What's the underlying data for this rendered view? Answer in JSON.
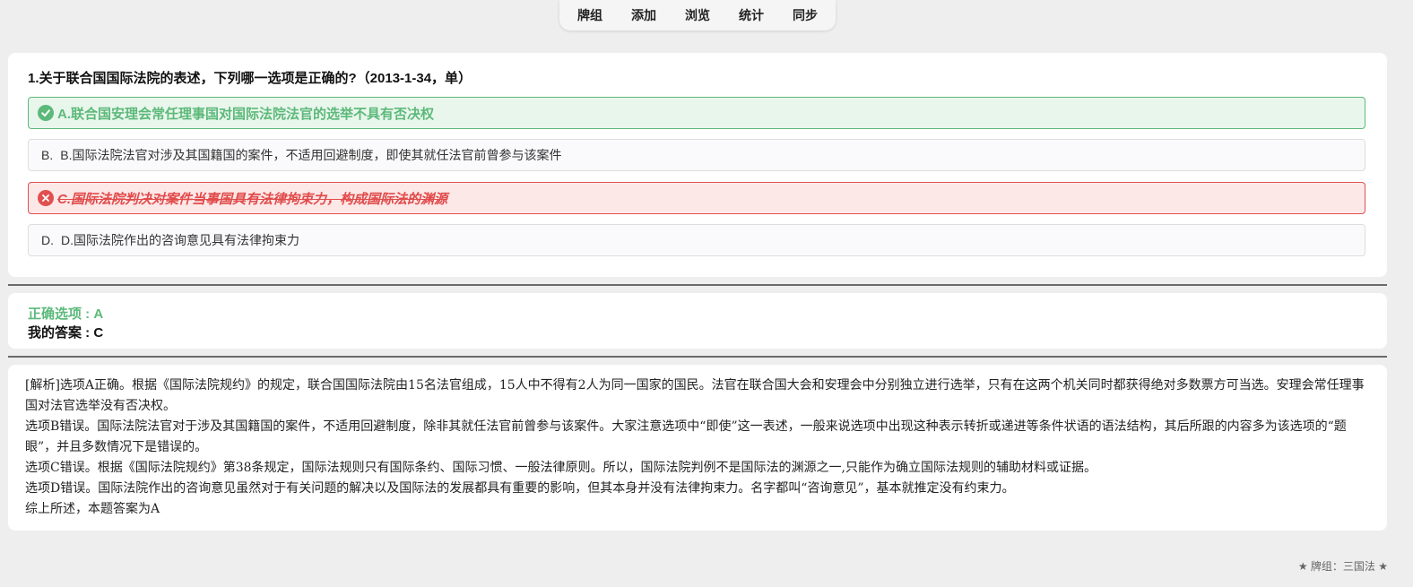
{
  "nav": {
    "items": [
      "牌组",
      "添加",
      "浏览",
      "统计",
      "同步"
    ]
  },
  "question": {
    "text": "1.关于联合国国际法院的表述，下列哪一选项是正确的?（2013-1-34，单）",
    "options": [
      {
        "label": "A.联合国安理会常任理事国对国际法院法官的选举不具有否决权",
        "state": "correct"
      },
      {
        "prefix": "B.",
        "label": "B.国际法院法官对涉及其国籍国的案件，不适用回避制度，即使其就任法官前曾参与该案件",
        "state": "normal"
      },
      {
        "label": "C.国际法院判决对案件当事国具有法律拘束力，构成国际法的渊源",
        "state": "wrong"
      },
      {
        "prefix": "D.",
        "label": "D.国际法院作出的咨询意见具有法律拘束力",
        "state": "normal"
      }
    ]
  },
  "answer": {
    "correct_text": "正确选项 : A",
    "mine_text": "我的答案 : C"
  },
  "explanation": {
    "lines": [
      "[解析]选项A正确。根据《国际法院规约》的规定，联合国国际法院由15名法官组成，15人中不得有2人为同一国家的国民。法官在联合国大会和安理会中分别独立进行选举，只有在这两个机关同时都获得绝对多数票方可当选。安理会常任理事国对法官选举没有否决权。",
      "选项B错误。国际法院法官对于涉及其国籍国的案件，不适用回避制度，除非其就任法官前曾参与该案件。大家注意选项中“即使”这一表述，一般来说选项中出现这种表示转折或递进等条件状语的语法结构，其后所跟的内容多为该选项的“题眼”，并且多数情况下是错误的。",
      "选项C错误。根据《国际法院规约》第38条规定，国际法规则只有国际条约、国际习惯、一般法律原则。所以，国际法院判例不是国际法的渊源之一,只能作为确立国际法规则的辅助材料或证据。",
      "选项D错误。国际法院作出的咨询意见虽然对于有关问题的解决以及国际法的发展都具有重要的影响，但其本身并没有法律拘束力。名字都叫“咨询意见”，基本就推定没有约束力。",
      "综上所述，本题答案为A"
    ]
  },
  "footer": {
    "text": "★ 牌组：三国法 ★"
  },
  "colors": {
    "correct": "#5cb97a",
    "wrong": "#e05050"
  }
}
